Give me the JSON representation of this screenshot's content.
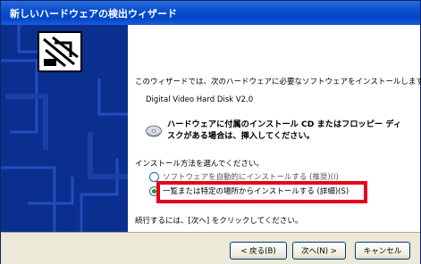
{
  "window": {
    "title": "新しいハードウェアの検出ウィザード"
  },
  "main": {
    "intro": "このウィザードでは、次のハードウェアに必要なソフトウェアをインストールします:",
    "device": "Digital Video Hard Disk V2.0",
    "insert_notice": "ハードウェアに付属のインストール CD またはフロッピー ディスクがある場合は、挿入してください。",
    "method_prompt": "インストール方法を選んでください。",
    "option_auto": "ソフトウェアを自動的にインストールする (推奨)(I)",
    "option_manual": "一覧または特定の場所からインストールする (詳細)(S)",
    "continue_hint": "続行するには、[次へ] をクリックしてください。"
  },
  "buttons": {
    "back": "< 戻る(B)",
    "next": "次へ(N) >",
    "cancel": "キャンセル"
  }
}
